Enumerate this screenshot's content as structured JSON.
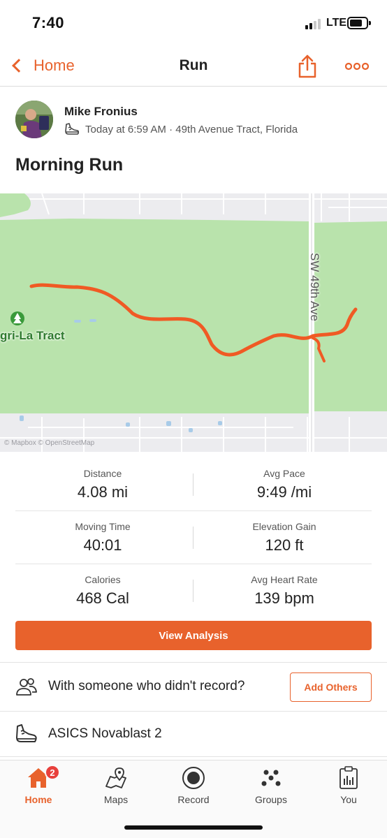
{
  "status_bar": {
    "time": "7:40",
    "network": "LTE"
  },
  "header": {
    "back_label": "Home",
    "title": "Run"
  },
  "athlete": {
    "name": "Mike Fronius",
    "meta": "Today at 6:59 AM · 49th Avenue Tract, Florida"
  },
  "activity": {
    "title": "Morning Run"
  },
  "map": {
    "road_label": "SW 49th Ave",
    "park_label": "gri-La Tract",
    "attribution": "© Mapbox © OpenStreetMap",
    "route_color": "#f05a24",
    "park_color": "#b9e3ac"
  },
  "stats": [
    [
      {
        "label": "Distance",
        "value": "4.08 mi"
      },
      {
        "label": "Avg Pace",
        "value": "9:49 /mi"
      }
    ],
    [
      {
        "label": "Moving Time",
        "value": "40:01"
      },
      {
        "label": "Elevation Gain",
        "value": "120 ft"
      }
    ],
    [
      {
        "label": "Calories",
        "value": "468 Cal"
      },
      {
        "label": "Avg Heart Rate",
        "value": "139 bpm"
      }
    ]
  ],
  "analysis_button": "View Analysis",
  "with_others": {
    "text": "With someone who didn't record?",
    "button": "Add Others"
  },
  "gear": {
    "text": "ASICS Novablast 2"
  },
  "tabbar": {
    "badge": "2",
    "tabs": [
      {
        "label": "Home",
        "icon": "home-icon"
      },
      {
        "label": "Maps",
        "icon": "map-pin-icon"
      },
      {
        "label": "Record",
        "icon": "record-icon"
      },
      {
        "label": "Groups",
        "icon": "groups-icon"
      },
      {
        "label": "You",
        "icon": "profile-clipboard-icon"
      }
    ]
  },
  "colors": {
    "accent": "#e8622c",
    "badge": "#e8403c"
  }
}
